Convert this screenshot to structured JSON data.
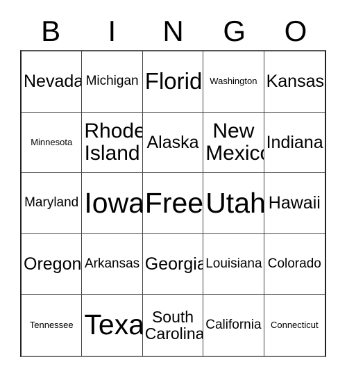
{
  "card": {
    "title": "BINGO Card",
    "header_letters": [
      "B",
      "I",
      "N",
      "G",
      "O"
    ],
    "grid_size": "5x5",
    "colors": {
      "background": "#ffffff",
      "text": "#000000",
      "border": "#444444",
      "outer_border": "#222222"
    },
    "cells": [
      {
        "text": "Nevada",
        "column": "B",
        "row": 1,
        "size": "md",
        "free": false
      },
      {
        "text": "Michigan",
        "column": "I",
        "row": 1,
        "size": "sm",
        "free": false
      },
      {
        "text": "Florida",
        "column": "N",
        "row": 1,
        "size": "lg",
        "free": false
      },
      {
        "text": "Washington",
        "column": "G",
        "row": 1,
        "size": "xs",
        "free": false
      },
      {
        "text": "Kansas",
        "column": "O",
        "row": 1,
        "size": "md",
        "free": false
      },
      {
        "text": "Minnesota",
        "column": "B",
        "row": 2,
        "size": "xs",
        "free": false
      },
      {
        "text": "Rhode\nIsland",
        "column": "I",
        "row": 2,
        "size": "two-lg",
        "free": false
      },
      {
        "text": "Alaska",
        "column": "N",
        "row": 2,
        "size": "md",
        "free": false
      },
      {
        "text": "New\nMexico",
        "column": "G",
        "row": 2,
        "size": "two-lg",
        "free": false
      },
      {
        "text": "Indiana",
        "column": "O",
        "row": 2,
        "size": "md",
        "free": false
      },
      {
        "text": "Maryland",
        "column": "B",
        "row": 3,
        "size": "sm",
        "free": false
      },
      {
        "text": "Iowa",
        "column": "I",
        "row": 3,
        "size": "xl",
        "free": false
      },
      {
        "text": "Free!",
        "column": "N",
        "row": 3,
        "size": "xl",
        "free": true
      },
      {
        "text": "Utah",
        "column": "G",
        "row": 3,
        "size": "xl",
        "free": false
      },
      {
        "text": "Hawaii",
        "column": "O",
        "row": 3,
        "size": "md",
        "free": false
      },
      {
        "text": "Oregon",
        "column": "B",
        "row": 4,
        "size": "md",
        "free": false
      },
      {
        "text": "Arkansas",
        "column": "I",
        "row": 4,
        "size": "sm",
        "free": false
      },
      {
        "text": "Georgia",
        "column": "N",
        "row": 4,
        "size": "md",
        "free": false
      },
      {
        "text": "Louisiana",
        "column": "G",
        "row": 4,
        "size": "sm",
        "free": false
      },
      {
        "text": "Colorado",
        "column": "O",
        "row": 4,
        "size": "sm",
        "free": false
      },
      {
        "text": "Tennessee",
        "column": "B",
        "row": 5,
        "size": "xs",
        "free": false
      },
      {
        "text": "Texas",
        "column": "I",
        "row": 5,
        "size": "xl",
        "free": false
      },
      {
        "text": "South\nCarolina",
        "column": "N",
        "row": 5,
        "size": "two-md",
        "free": false
      },
      {
        "text": "California",
        "column": "G",
        "row": 5,
        "size": "sm",
        "free": false
      },
      {
        "text": "Connecticut",
        "column": "O",
        "row": 5,
        "size": "xs",
        "free": false
      }
    ]
  }
}
